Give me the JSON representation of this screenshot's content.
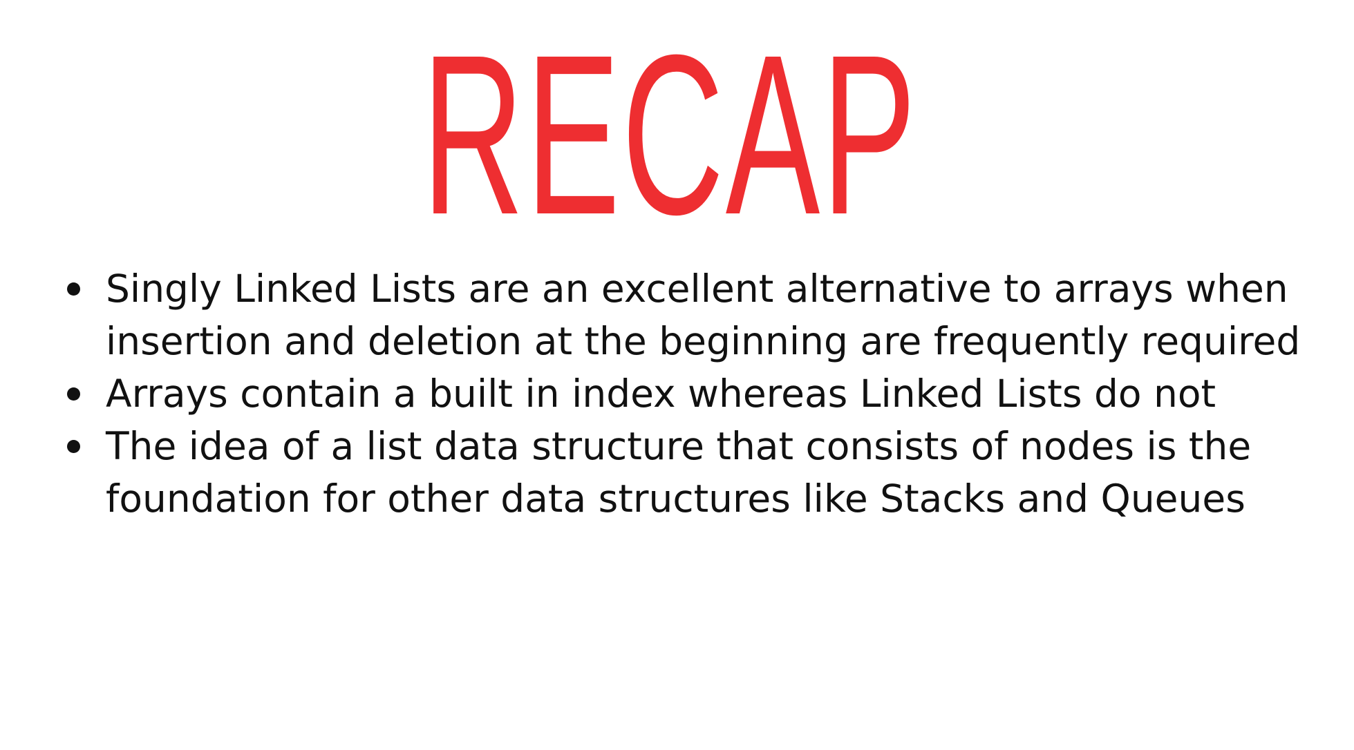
{
  "slide": {
    "title": "RECAP",
    "title_color": "#ee2e31",
    "bullets": [
      "Singly Linked Lists are an excellent alternative to arrays when insertion and deletion at the beginning are frequently required",
      "Arrays contain a built in index whereas Linked Lists do not",
      "The idea of a list data structure that consists of nodes is the foundation for other data structures like Stacks and Queues"
    ]
  }
}
